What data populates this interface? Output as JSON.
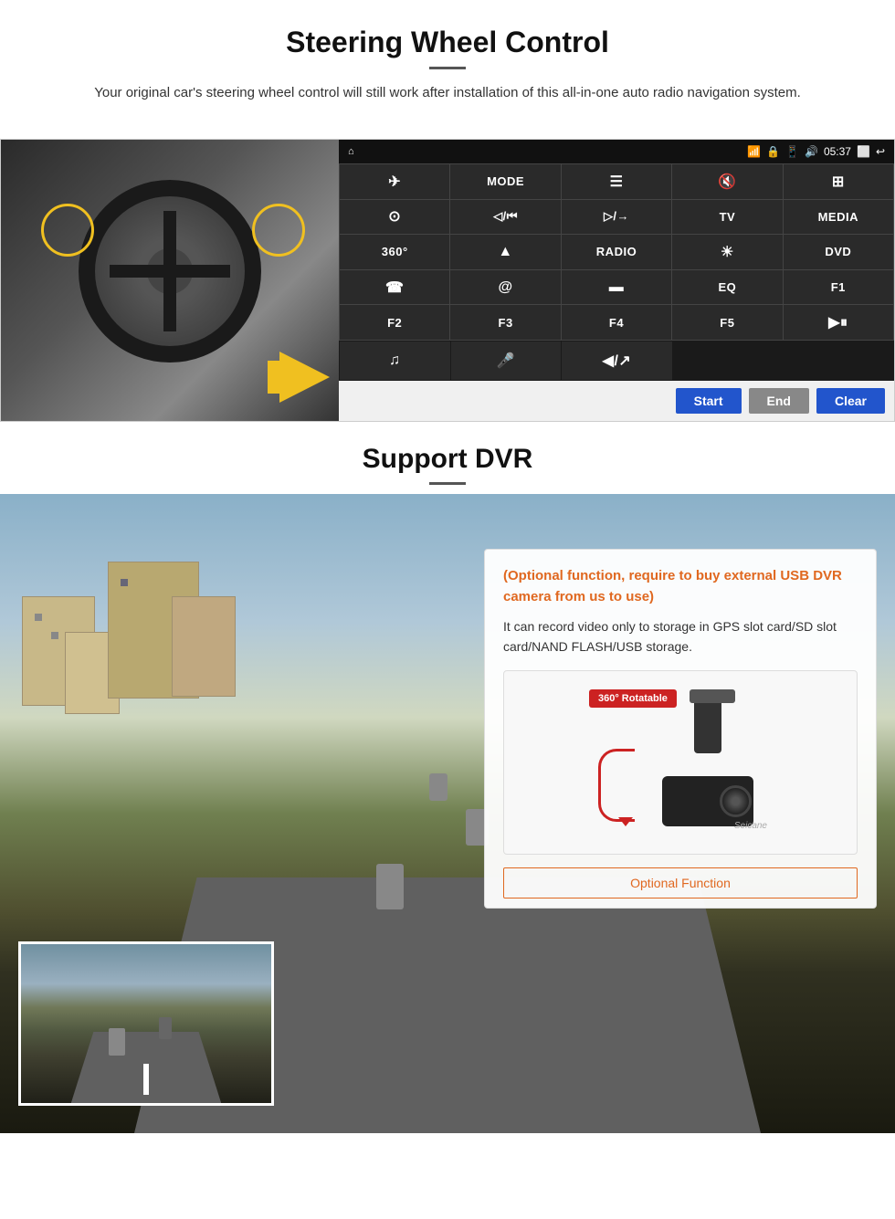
{
  "steering": {
    "title": "Steering Wheel Control",
    "subtitle_line": "",
    "description": "Your original car's steering wheel control will still work after installation of this all-in-one auto radio navigation system.",
    "statusbar": {
      "time": "05:37",
      "home_icon": "⌂",
      "wifi_icon": "WiFi",
      "lock_icon": "🔒",
      "screen_icon": "📱",
      "vol_icon": "🔊",
      "window_icon": "⬜",
      "back_icon": "↩"
    },
    "buttons": [
      {
        "label": "✈",
        "row": 1,
        "col": 1
      },
      {
        "label": "MODE",
        "row": 1,
        "col": 2
      },
      {
        "label": "☰",
        "row": 1,
        "col": 3
      },
      {
        "label": "🔇",
        "row": 1,
        "col": 4
      },
      {
        "label": "⊞",
        "row": 1,
        "col": 5
      },
      {
        "label": "⊙",
        "row": 2,
        "col": 1
      },
      {
        "label": "◁/⏮",
        "row": 2,
        "col": 2
      },
      {
        "label": "▷/→",
        "row": 2,
        "col": 3
      },
      {
        "label": "TV",
        "row": 2,
        "col": 4
      },
      {
        "label": "MEDIA",
        "row": 2,
        "col": 5
      },
      {
        "label": "360",
        "row": 3,
        "col": 1
      },
      {
        "label": "▲",
        "row": 3,
        "col": 2
      },
      {
        "label": "RADIO",
        "row": 3,
        "col": 3
      },
      {
        "label": "☀",
        "row": 3,
        "col": 4
      },
      {
        "label": "DVD",
        "row": 3,
        "col": 5
      },
      {
        "label": "☎",
        "row": 4,
        "col": 1
      },
      {
        "label": "@",
        "row": 4,
        "col": 2
      },
      {
        "label": "▬",
        "row": 4,
        "col": 3
      },
      {
        "label": "EQ",
        "row": 4,
        "col": 4
      },
      {
        "label": "F1",
        "row": 4,
        "col": 5
      },
      {
        "label": "F2",
        "row": 5,
        "col": 1
      },
      {
        "label": "F3",
        "row": 5,
        "col": 2
      },
      {
        "label": "F4",
        "row": 5,
        "col": 3
      },
      {
        "label": "F5",
        "row": 5,
        "col": 4
      },
      {
        "label": "▶⏸",
        "row": 5,
        "col": 5
      }
    ],
    "extra_row": [
      {
        "label": "♫"
      },
      {
        "label": "🎤"
      },
      {
        "label": "◀/↗"
      }
    ],
    "controls": {
      "start": "Start",
      "end": "End",
      "clear": "Clear"
    }
  },
  "dvr": {
    "title": "Support DVR",
    "optional_text": "(Optional function, require to buy external USB DVR camera from us to use)",
    "description": "It can record video only to storage in GPS slot card/SD slot card/NAND FLASH/USB storage.",
    "camera_badge": "360° Rotatable",
    "watermark": "Seicane",
    "optional_function_label": "Optional Function"
  }
}
